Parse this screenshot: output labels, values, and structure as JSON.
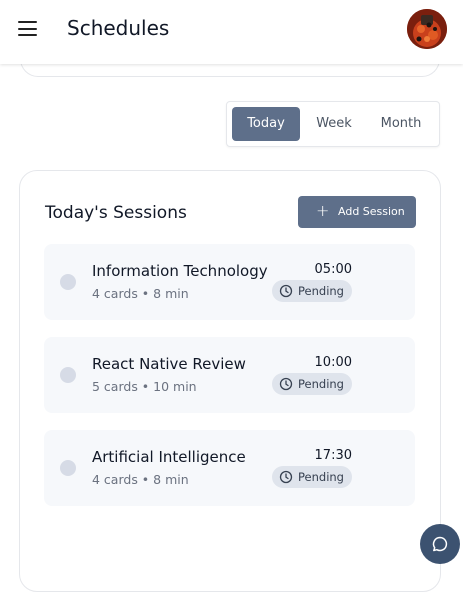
{
  "header": {
    "title": "Schedules"
  },
  "view_toggle": {
    "options": [
      "Today",
      "Week",
      "Month"
    ],
    "selected": "Today"
  },
  "sessions": {
    "title": "Today's Sessions",
    "add_label": "Add Session",
    "items": [
      {
        "title": "Information Technology",
        "meta": "4 cards • 8 min",
        "time": "05:00",
        "status": "Pending"
      },
      {
        "title": "React Native Review",
        "meta": "5 cards • 10 min",
        "time": "10:00",
        "status": "Pending"
      },
      {
        "title": "Artificial Intelligence",
        "meta": "4 cards • 8 min",
        "time": "17:30",
        "status": "Pending"
      }
    ]
  },
  "colors": {
    "accent": "#5e6f8a",
    "fab": "#3c5270",
    "item_bg": "#f6f8fb",
    "badge_bg": "#dfe4ec"
  },
  "icons": {
    "menu": "hamburger-icon",
    "add": "plus-icon",
    "status": "clock-icon",
    "chat": "chat-bubble-icon"
  }
}
